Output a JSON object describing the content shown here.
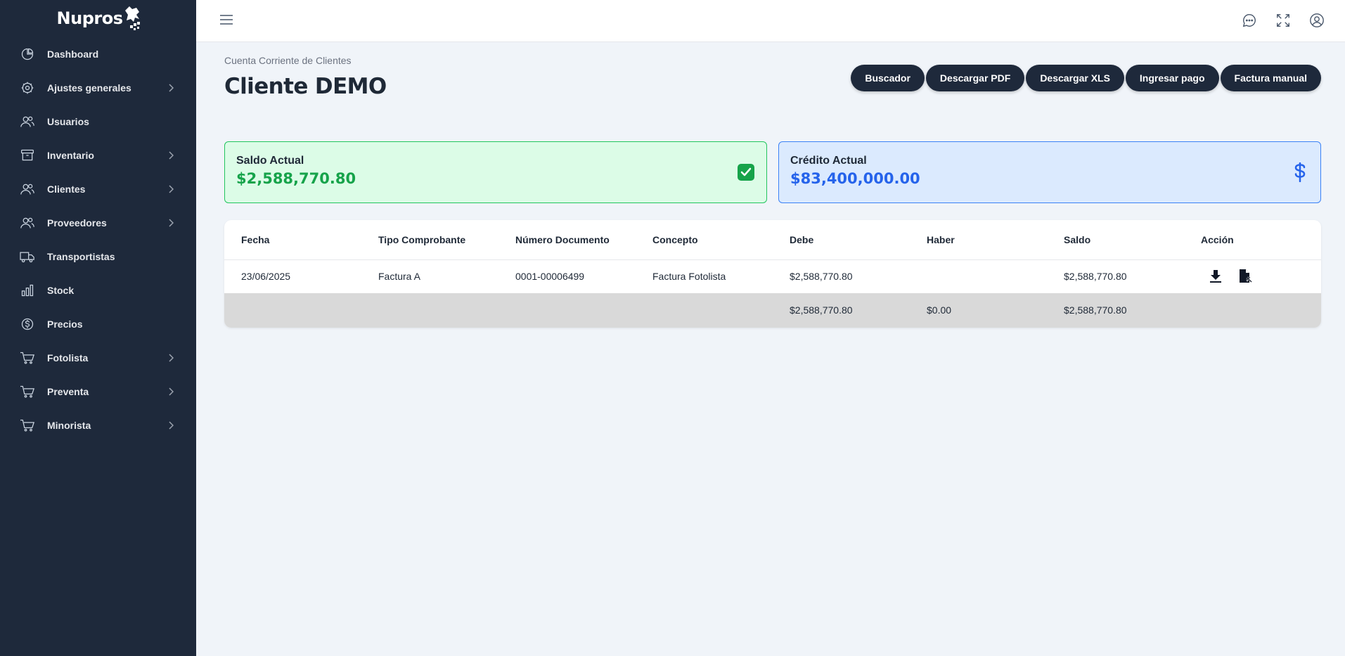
{
  "brand": {
    "name": "Nupros"
  },
  "sidebar": {
    "items": [
      {
        "label": "Dashboard",
        "icon": "pie-chart-icon",
        "has_submenu": false
      },
      {
        "label": "Ajustes generales",
        "icon": "gear-icon",
        "has_submenu": true
      },
      {
        "label": "Usuarios",
        "icon": "users-icon",
        "has_submenu": false
      },
      {
        "label": "Inventario",
        "icon": "archive-icon",
        "has_submenu": true
      },
      {
        "label": "Clientes",
        "icon": "users-icon",
        "has_submenu": true
      },
      {
        "label": "Proveedores",
        "icon": "users-icon",
        "has_submenu": true
      },
      {
        "label": "Transportistas",
        "icon": "truck-icon",
        "has_submenu": false
      },
      {
        "label": "Stock",
        "icon": "bar-chart-icon",
        "has_submenu": false
      },
      {
        "label": "Precios",
        "icon": "dollar-circle-icon",
        "has_submenu": false
      },
      {
        "label": "Fotolista",
        "icon": "cart-icon",
        "has_submenu": true
      },
      {
        "label": "Preventa",
        "icon": "cart-icon",
        "has_submenu": true
      },
      {
        "label": "Minorista",
        "icon": "cart-icon",
        "has_submenu": true
      }
    ]
  },
  "topbar": {
    "icons": [
      "chat-icon",
      "fullscreen-icon",
      "user-circle-icon"
    ]
  },
  "header": {
    "breadcrumb": "Cuenta Corriente de Clientes",
    "title": "Cliente DEMO",
    "buttons": {
      "search": "Buscador",
      "pdf": "Descargar PDF",
      "xls": "Descargar XLS",
      "payment": "Ingresar pago",
      "manual_invoice": "Factura manual"
    }
  },
  "cards": {
    "balance": {
      "label": "Saldo Actual",
      "value": "$2,588,770.80",
      "color": "#16a34a"
    },
    "credit": {
      "label": "Crédito Actual",
      "value": "$83,400,000.00",
      "color": "#2563eb"
    }
  },
  "table": {
    "columns": [
      "Fecha",
      "Tipo Comprobante",
      "Número Documento",
      "Concepto",
      "Debe",
      "Haber",
      "Saldo",
      "Acción"
    ],
    "rows": [
      {
        "fecha": "23/06/2025",
        "tipo": "Factura A",
        "numero": "0001-00006499",
        "concepto": "Factura Fotolista",
        "debe": "$2,588,770.80",
        "haber": "",
        "saldo": "$2,588,770.80"
      }
    ],
    "totals": {
      "debe": "$2,588,770.80",
      "haber": "$0.00",
      "saldo": "$2,588,770.80"
    }
  }
}
